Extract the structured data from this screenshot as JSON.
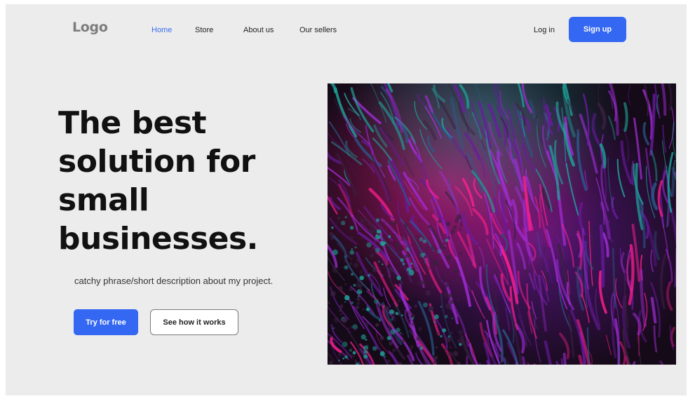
{
  "header": {
    "logo": "Logo",
    "nav": [
      {
        "label": "Home",
        "active": true
      },
      {
        "label": "Store",
        "active": false
      },
      {
        "label": "About us",
        "active": false
      },
      {
        "label": "Our sellers",
        "active": false
      }
    ],
    "login_label": "Log in",
    "signup_label": "Sign up"
  },
  "hero": {
    "headline_lines": [
      "The best",
      "solution for",
      "small",
      "businesses."
    ],
    "tagline": "catchy phrase/short description about my project.",
    "primary_cta": "Try for free",
    "secondary_cta": "See how it works",
    "image": {
      "icon": "abstract-fractal-image",
      "colors": [
        "#ff1f8e",
        "#a12cd6",
        "#6a1aa0",
        "#1fa39a",
        "#2a5a8a",
        "#3a2040"
      ]
    }
  },
  "theme": {
    "accent": "#3468f3",
    "background": "#ececec"
  }
}
